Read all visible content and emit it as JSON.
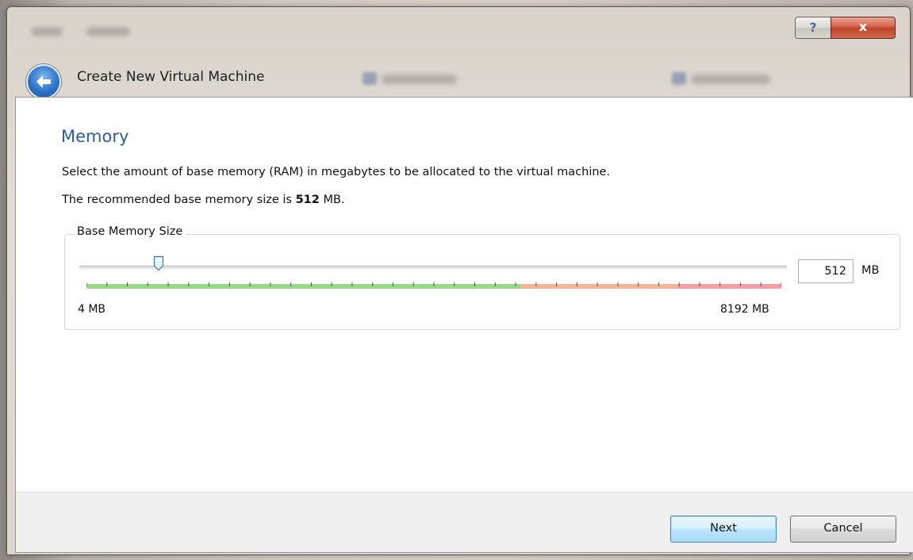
{
  "window": {
    "help_label": "?",
    "close_label": "x",
    "back_icon": "back-arrow-icon"
  },
  "wizard": {
    "title": "Create New Virtual Machine"
  },
  "page": {
    "heading": "Memory",
    "description_line1": "Select the amount of base memory (RAM) in megabytes to be allocated to the virtual machine.",
    "recommended_prefix": "The recommended base memory size is ",
    "recommended_value": "512",
    "recommended_suffix": " MB."
  },
  "memory": {
    "group_label": "Base Memory Size",
    "min_label": "4 MB",
    "max_label": "8192 MB",
    "min_mb": 4,
    "max_mb": 8192,
    "value_mb": 512,
    "input_value": "512",
    "unit": "MB",
    "zones": {
      "green_end_fraction": 0.625,
      "orange_end_fraction": 0.85
    },
    "colors": {
      "green": "#9ad88c",
      "orange": "#f0b79a",
      "red": "#f0a0a6"
    }
  },
  "buttons": {
    "next": "Next",
    "cancel": "Cancel"
  },
  "colors": {
    "heading": "#2f5b93",
    "close_button": "#c0432b"
  }
}
